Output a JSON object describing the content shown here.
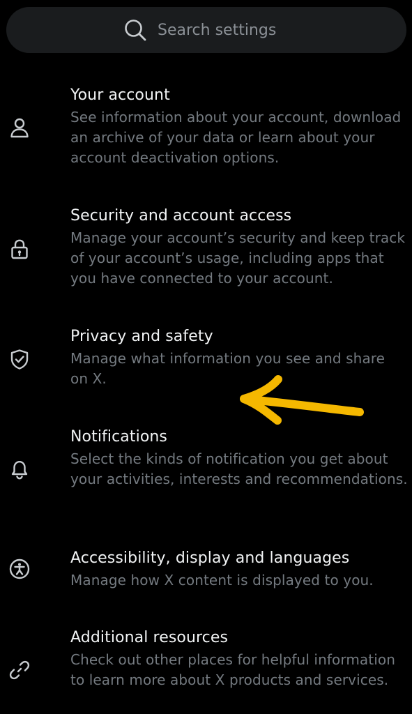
{
  "search": {
    "placeholder": "Search settings",
    "icon": "search-icon"
  },
  "settings": [
    {
      "icon": "person-icon",
      "title": "Your account",
      "description": "See information about your account, download an archive of your data or learn about your account deactivation options."
    },
    {
      "icon": "lock-icon",
      "title": "Security and account access",
      "description": "Manage your account’s security and keep track of your account’s usage, including apps that you have connected to your account."
    },
    {
      "icon": "shield-check-icon",
      "title": "Privacy and safety",
      "description": "Manage what information you see and share on X."
    },
    {
      "icon": "bell-icon",
      "title": "Notifications",
      "description": "Select the kinds of notification you get about your activities, interests and recommendations."
    },
    {
      "icon": "accessibility-icon",
      "title": "Accessibility, display and languages",
      "description": "Manage how X content is displayed to you."
    },
    {
      "icon": "link-icon",
      "title": "Additional resources",
      "description": "Check out other places for helpful information to learn more about X products and services."
    }
  ],
  "colors": {
    "background": "#000000",
    "search_bar": "#1a1c1e",
    "title_text": "#f2f4f5",
    "description_text": "#747a80",
    "icon": "#c8ccd0",
    "annotation_arrow": "#f5b800"
  },
  "annotation": {
    "type": "hand-drawn-arrow",
    "points_to": "Privacy and safety"
  }
}
